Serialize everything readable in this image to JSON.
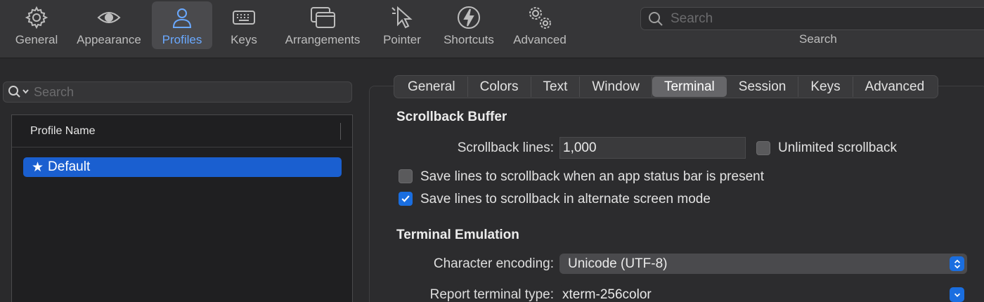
{
  "toolbar": {
    "items": [
      {
        "label": "General",
        "icon": "gear-icon"
      },
      {
        "label": "Appearance",
        "icon": "eye-icon"
      },
      {
        "label": "Profiles",
        "icon": "person-icon"
      },
      {
        "label": "Keys",
        "icon": "keyboard-icon"
      },
      {
        "label": "Arrangements",
        "icon": "windows-icon"
      },
      {
        "label": "Pointer",
        "icon": "pointer-icon"
      },
      {
        "label": "Shortcuts",
        "icon": "lightning-icon"
      },
      {
        "label": "Advanced",
        "icon": "gears-icon"
      }
    ],
    "active": "Profiles",
    "search_placeholder": "Search",
    "search_caption": "Search"
  },
  "sidebar": {
    "search_placeholder": "Search",
    "table_header": "Profile Name",
    "profiles": [
      {
        "name": "Default",
        "selected": true
      }
    ]
  },
  "tabs": {
    "items": [
      "General",
      "Colors",
      "Text",
      "Window",
      "Terminal",
      "Session",
      "Keys",
      "Advanced"
    ],
    "active": "Terminal"
  },
  "scrollback": {
    "title": "Scrollback Buffer",
    "lines_label": "Scrollback lines:",
    "lines_value": "1,000",
    "unlimited_label": "Unlimited scrollback",
    "unlimited_checked": false,
    "status_bar_label": "Save lines to scrollback when an app status bar is present",
    "status_bar_checked": false,
    "alt_screen_label": "Save lines to scrollback in alternate screen mode",
    "alt_screen_checked": true
  },
  "emulation": {
    "title": "Terminal Emulation",
    "encoding_label": "Character encoding:",
    "encoding_value": "Unicode (UTF-8)",
    "term_type_label": "Report terminal type:",
    "term_type_value": "xterm-256color"
  },
  "colors": {
    "accent": "#1a6ee0",
    "selection": "#1a5fd0",
    "active_toolbar_text": "#6aa9ff"
  }
}
